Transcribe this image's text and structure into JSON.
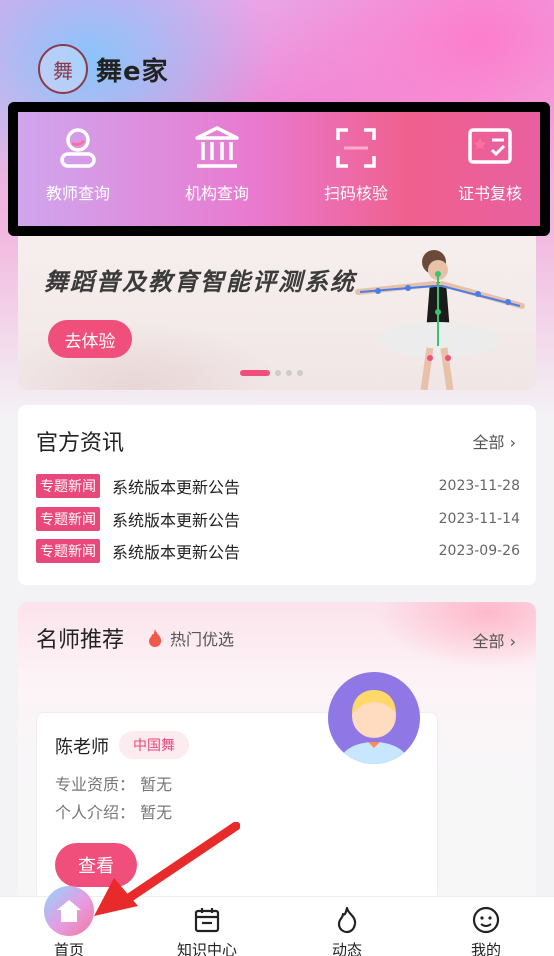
{
  "app": {
    "name": "舞e家",
    "logo_glyph": "舞"
  },
  "quick_menu": [
    {
      "label": "教师查询",
      "icon": "teacher-icon"
    },
    {
      "label": "机构查询",
      "icon": "institution-icon"
    },
    {
      "label": "扫码核验",
      "icon": "scan-icon"
    },
    {
      "label": "证书复核",
      "icon": "certificate-icon"
    }
  ],
  "banner": {
    "title": "舞蹈普及教育智能评测系统",
    "button": "去体验",
    "slide_count": 4,
    "active_slide": 0
  },
  "news": {
    "title": "官方资讯",
    "more": "全部",
    "items": [
      {
        "tag": "专题新闻",
        "text": "系统版本更新公告",
        "date": "2023-11-28"
      },
      {
        "tag": "专题新闻",
        "text": "系统版本更新公告",
        "date": "2023-11-14"
      },
      {
        "tag": "专题新闻",
        "text": "系统版本更新公告",
        "date": "2023-09-26"
      }
    ]
  },
  "teachers": {
    "title": "名师推荐",
    "hot": "热门优选",
    "more": "全部",
    "card": {
      "name": "陈老师",
      "badge": "中国舞",
      "qualification": "专业资质：  暂无",
      "intro": "个人介绍：  暂无",
      "button": "查看"
    }
  },
  "tabbar": [
    {
      "label": "首页",
      "icon": "home-icon",
      "active": true
    },
    {
      "label": "知识中心",
      "icon": "calendar-icon"
    },
    {
      "label": "动态",
      "icon": "flame-icon"
    },
    {
      "label": "我的",
      "icon": "smile-icon"
    }
  ],
  "colors": {
    "accent": "#ef4f7a",
    "tag": "#e9487a"
  }
}
